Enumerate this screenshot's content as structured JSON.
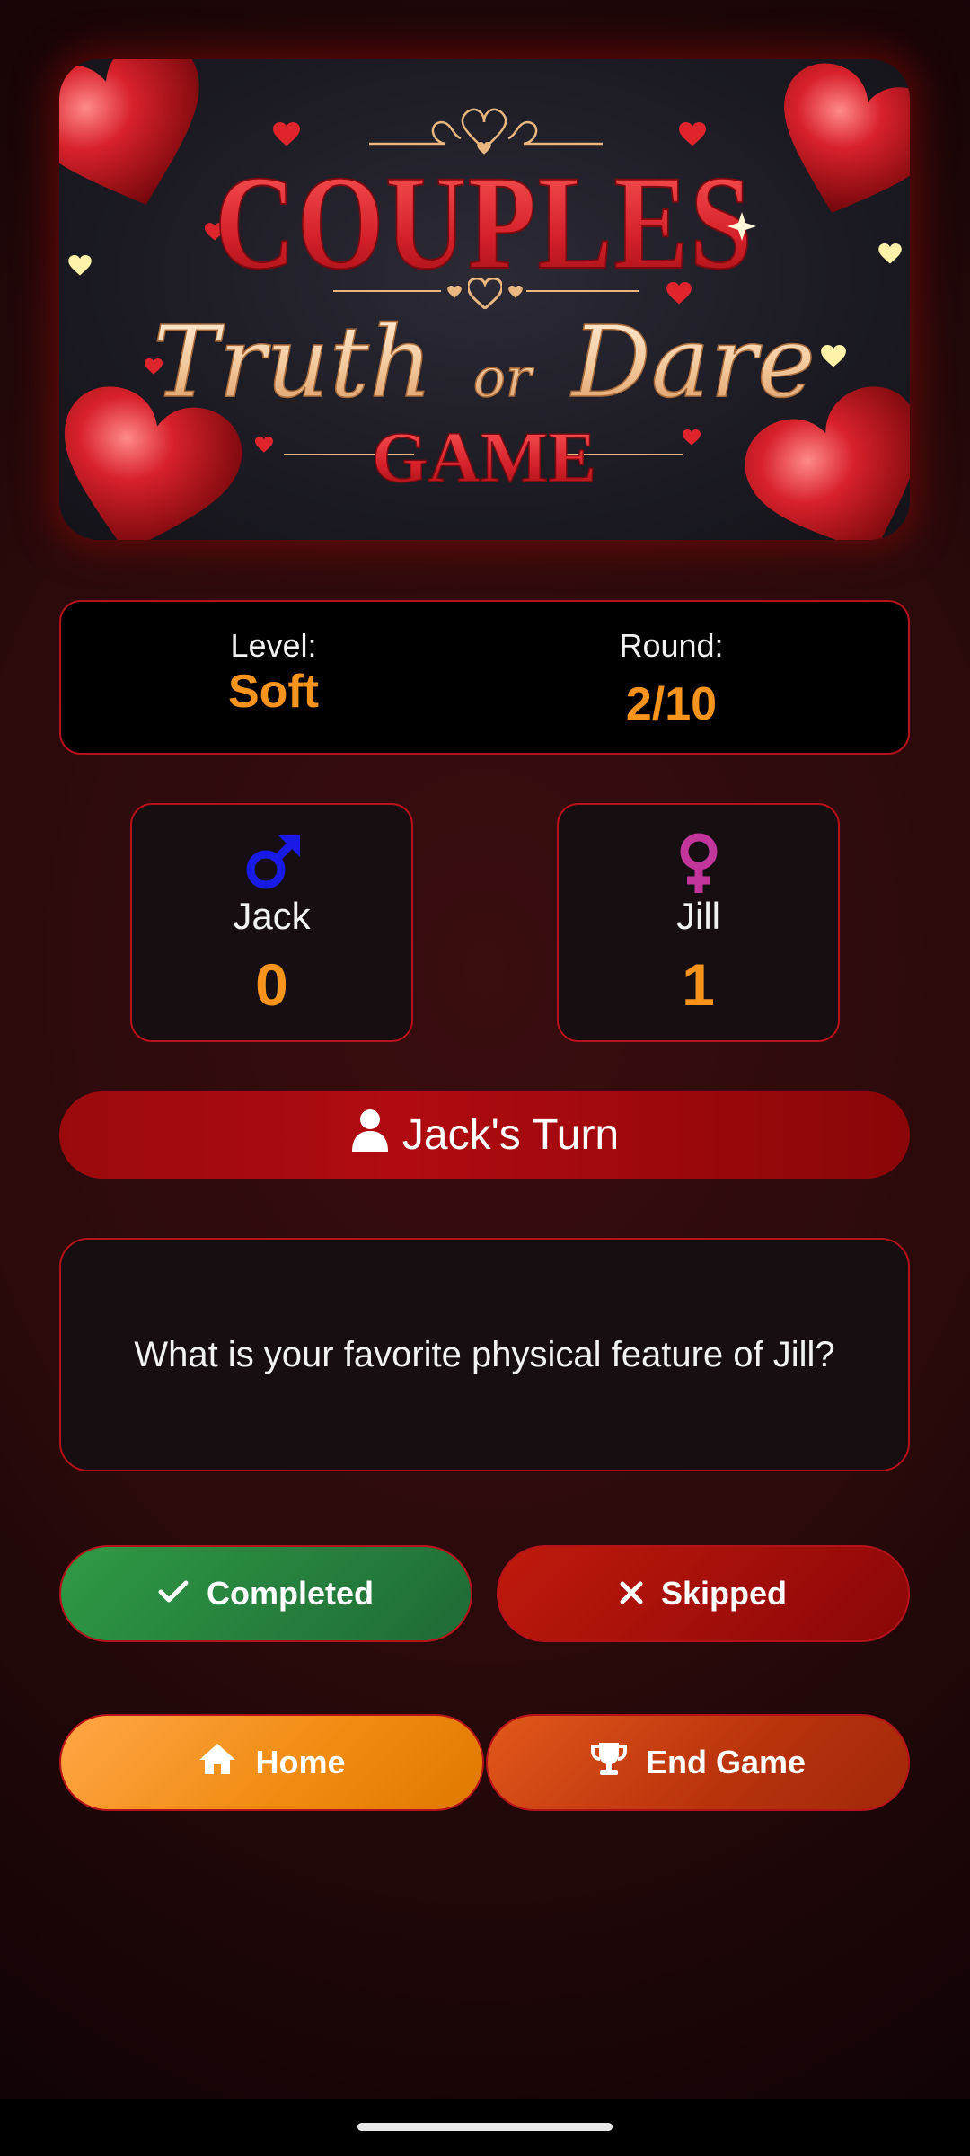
{
  "banner": {
    "line1": "COUPLES",
    "line2a": "Truth",
    "line2b": "or",
    "line2c": "Dare",
    "line3": "GAME"
  },
  "info": {
    "level_label": "Level:",
    "level_value": "Soft",
    "round_label": "Round:",
    "round_value": "2/10"
  },
  "players": [
    {
      "name": "Jack",
      "score": "0",
      "icon": "male-symbol-icon",
      "color": "#1a1ae6"
    },
    {
      "name": "Jill",
      "score": "1",
      "icon": "female-symbol-icon",
      "color": "#c2359a"
    }
  ],
  "turn": {
    "label": "Jack's Turn",
    "icon": "user-icon"
  },
  "question": {
    "text": "What is your favorite physical feature of Jill?"
  },
  "actions": {
    "completed": "Completed",
    "skipped": "Skipped",
    "home": "Home",
    "end_game": "End Game"
  },
  "colors": {
    "accent_orange": "#f7941d",
    "border_red": "#b5121b",
    "green": "#2f9a45",
    "red": "#b00b10"
  }
}
